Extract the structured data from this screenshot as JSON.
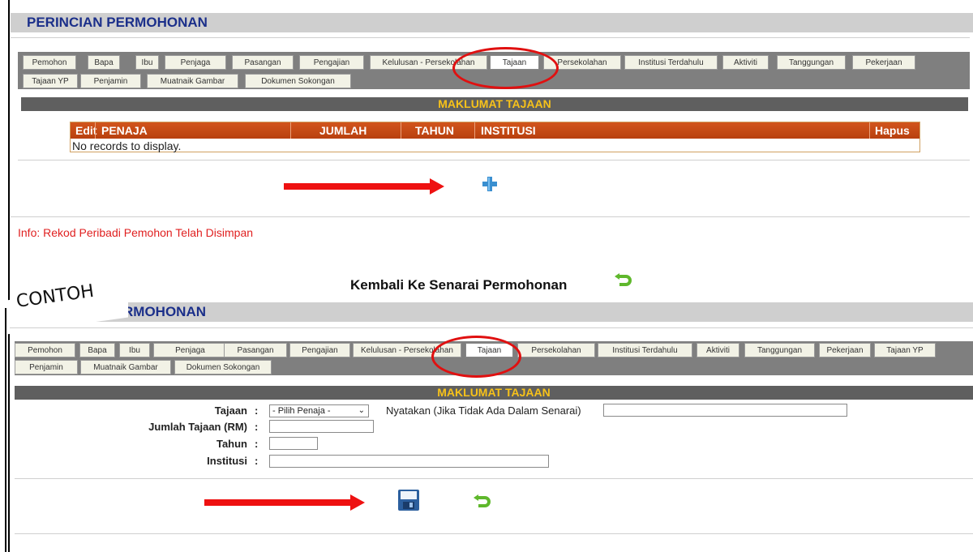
{
  "top": {
    "title": "PERINCIAN PERMOHONAN",
    "tabs_row1": [
      "Pemohon",
      "Bapa",
      "Ibu",
      "Penjaga",
      "Pasangan",
      "Pengajian",
      "Kelulusan - Persekolahan",
      "Tajaan",
      "Persekolahan",
      "Institusi Terdahulu",
      "Aktiviti",
      "Tanggungan",
      "Pekerjaan"
    ],
    "tabs_row2": [
      "Tajaan YP",
      "Penjamin",
      "Muatnaik Gambar",
      "Dokumen Sokongan"
    ],
    "section_title": "MAKLUMAT TAJAAN",
    "grid_headers": {
      "edit": "Edit",
      "penaja": "PENAJA",
      "jumlah": "JUMLAH",
      "tahun": "TAHUN",
      "institusi": "INSTITUSI",
      "hapus": "Hapus"
    },
    "empty_text": "No records to display.",
    "info": "Info: Rekod Peribadi Pemohon Telah Disimpan",
    "back_label": "Kembali Ke Senarai Permohonan"
  },
  "bottom": {
    "stamp": "CONTOH",
    "title_partial": "RMOHONAN",
    "tabs_row1": [
      "Pemohon",
      "Bapa",
      "Ibu",
      "Penjaga",
      "Pasangan",
      "Pengajian",
      "Kelulusan - Persekolahan",
      "Tajaan",
      "Persekolahan",
      "Institusi Terdahulu",
      "Aktiviti",
      "Tanggungan",
      "Pekerjaan",
      "Tajaan YP"
    ],
    "tabs_row2": [
      "Penjamin",
      "Muatnaik Gambar",
      "Dokumen Sokongan"
    ],
    "section_title": "MAKLUMAT TAJAAN",
    "form": {
      "tajaan_label": "Tajaan",
      "tajaan_value": "- Pilih Penaja -",
      "nyatakan_label": "Nyatakan (Jika Tidak Ada Dalam Senarai)",
      "jumlah_label": "Jumlah Tajaan (RM)",
      "tahun_label": "Tahun",
      "institusi_label": "Institusi",
      "colon": ":"
    }
  },
  "colors": {
    "accent": "#1b2f8a",
    "section": "#5f5f5f",
    "grid_header": "#c8481a",
    "highlight": "#e01010",
    "gold": "#f7c21a"
  },
  "icons": [
    "plus-icon",
    "undo-icon",
    "save-icon"
  ]
}
